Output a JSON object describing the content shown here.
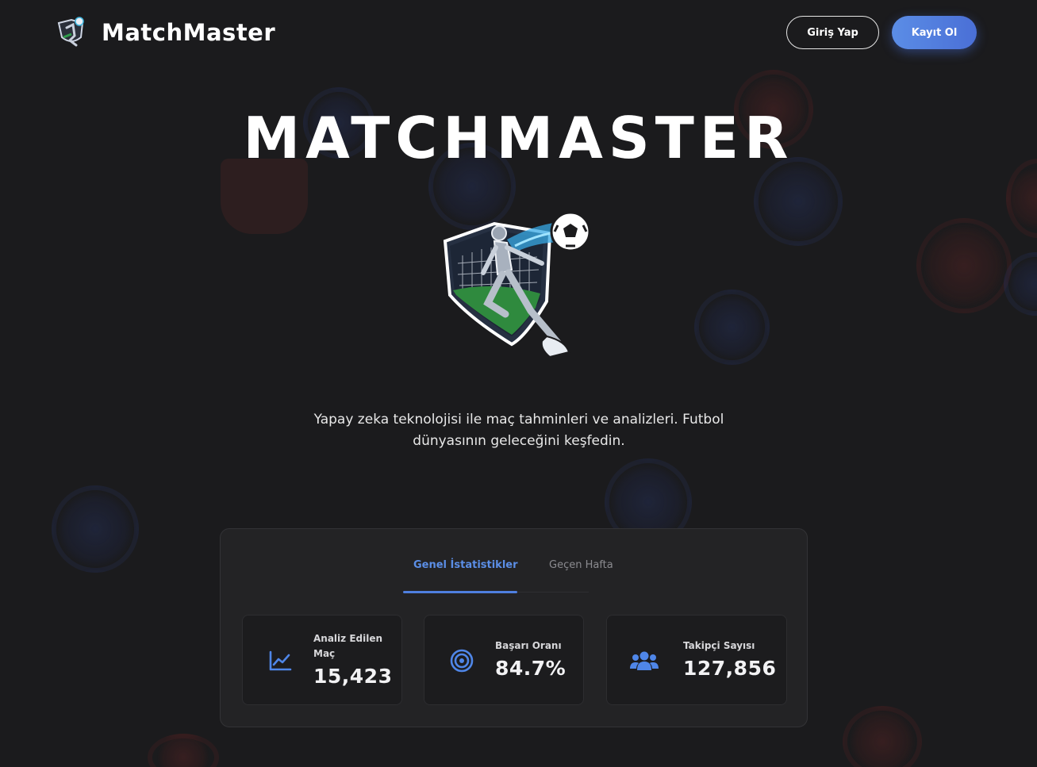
{
  "brand": {
    "name": "MatchMaster"
  },
  "header": {
    "login_label": "Giriş Yap",
    "register_label": "Kayıt Ol"
  },
  "hero": {
    "title": "MATCHMASTER",
    "description": "Yapay zeka teknolojisi ile maç tahminleri ve analizleri. Futbol dünyasının geleceğini keşfedin."
  },
  "stats": {
    "tabs": [
      {
        "label": "Genel İstatistikler",
        "active": true
      },
      {
        "label": "Geçen Hafta",
        "active": false
      }
    ],
    "cards": [
      {
        "icon": "line-chart-icon",
        "label": "Analiz Edilen Maç",
        "value": "15,423"
      },
      {
        "icon": "target-icon",
        "label": "Başarı Oranı",
        "value": "84.7%"
      },
      {
        "icon": "users-icon",
        "label": "Takipçi Sayısı",
        "value": "127,856"
      }
    ]
  },
  "colors": {
    "background": "#1b1b1d",
    "accent": "#5b8ee6",
    "panel": "#232325",
    "card": "#1c1c1e"
  }
}
